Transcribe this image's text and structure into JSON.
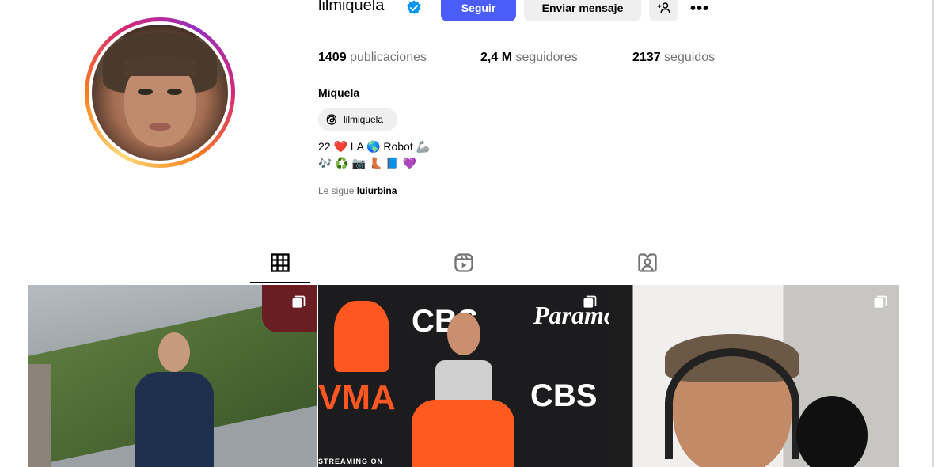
{
  "profile": {
    "username": "lilmiquela",
    "full_name": "Miquela",
    "threads_handle": "lilmiquela",
    "bio_line1": "22 ❤️ LA 🌎 Robot 🦾",
    "bio_line2": "🎶 ♻️ 📷 👢 📘 💜",
    "followed_by_prefix": "Le sigue",
    "followed_by_user": "luiurbina"
  },
  "actions": {
    "follow_label": "Seguir",
    "message_label": "Enviar mensaje",
    "more_label": "•••"
  },
  "stats": {
    "posts_count": "1409",
    "posts_label": "publicaciones",
    "followers_count": "2,4 M",
    "followers_label": "seguidores",
    "following_count": "2137",
    "following_label": "seguidos"
  },
  "posts": {
    "post2_cbs_top": "CBS",
    "post2_paramount": "Paramo",
    "post2_cbs_bottom": "CBS",
    "post2_vma": "VMA",
    "post2_streaming": "STREAMING ON"
  },
  "colors": {
    "follow_button": "#4a5df9",
    "verified_badge": "#0095f6"
  },
  "icons": [
    "verified-badge-icon",
    "add-person-icon",
    "threads-icon",
    "grid-icon",
    "reels-icon",
    "tagged-icon",
    "multi-post-icon"
  ]
}
